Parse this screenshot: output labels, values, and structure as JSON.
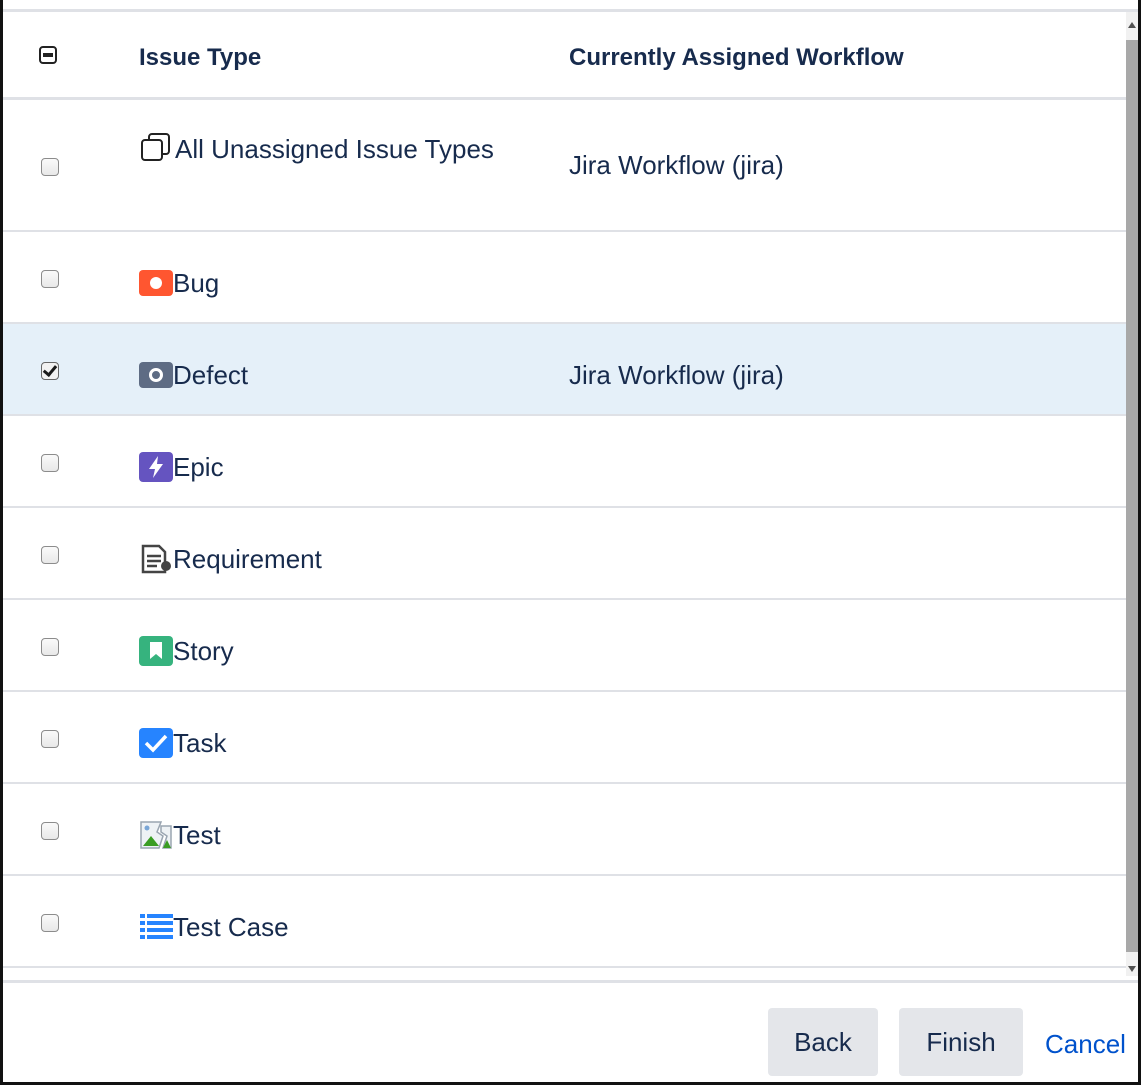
{
  "table": {
    "headers": {
      "issue_type": "Issue Type",
      "workflow": "Currently Assigned Workflow"
    },
    "rows": [
      {
        "icon": "subtask-stack-icon",
        "type": "All Unassigned Issue Types",
        "workflow": "Jira Workflow (jira)",
        "checked": false
      },
      {
        "icon": "bug-icon",
        "type": "Bug",
        "workflow": "",
        "checked": false
      },
      {
        "icon": "defect-icon",
        "type": "Defect",
        "workflow": "Jira Workflow (jira)",
        "checked": true
      },
      {
        "icon": "epic-lightning-icon",
        "type": "Epic",
        "workflow": "",
        "checked": false
      },
      {
        "icon": "requirement-document-icon",
        "type": "Requirement",
        "workflow": "",
        "checked": false
      },
      {
        "icon": "story-bookmark-icon",
        "type": "Story",
        "workflow": "",
        "checked": false
      },
      {
        "icon": "task-checkmark-icon",
        "type": "Task",
        "workflow": "",
        "checked": false
      },
      {
        "icon": "broken-image-icon",
        "type": "Test",
        "workflow": "",
        "checked": false
      },
      {
        "icon": "test-case-list-icon",
        "type": "Test Case",
        "workflow": "",
        "checked": false
      }
    ]
  },
  "footer": {
    "back_label": "Back",
    "finish_label": "Finish",
    "cancel_label": "Cancel"
  },
  "colors": {
    "bug": "#ff5630",
    "defect": "#5e6c84",
    "epic": "#6554c0",
    "story": "#36b37e",
    "task": "#2684ff",
    "test_case": "#2684ff",
    "link": "#0052cc",
    "selected_row": "#e5f0f9"
  }
}
